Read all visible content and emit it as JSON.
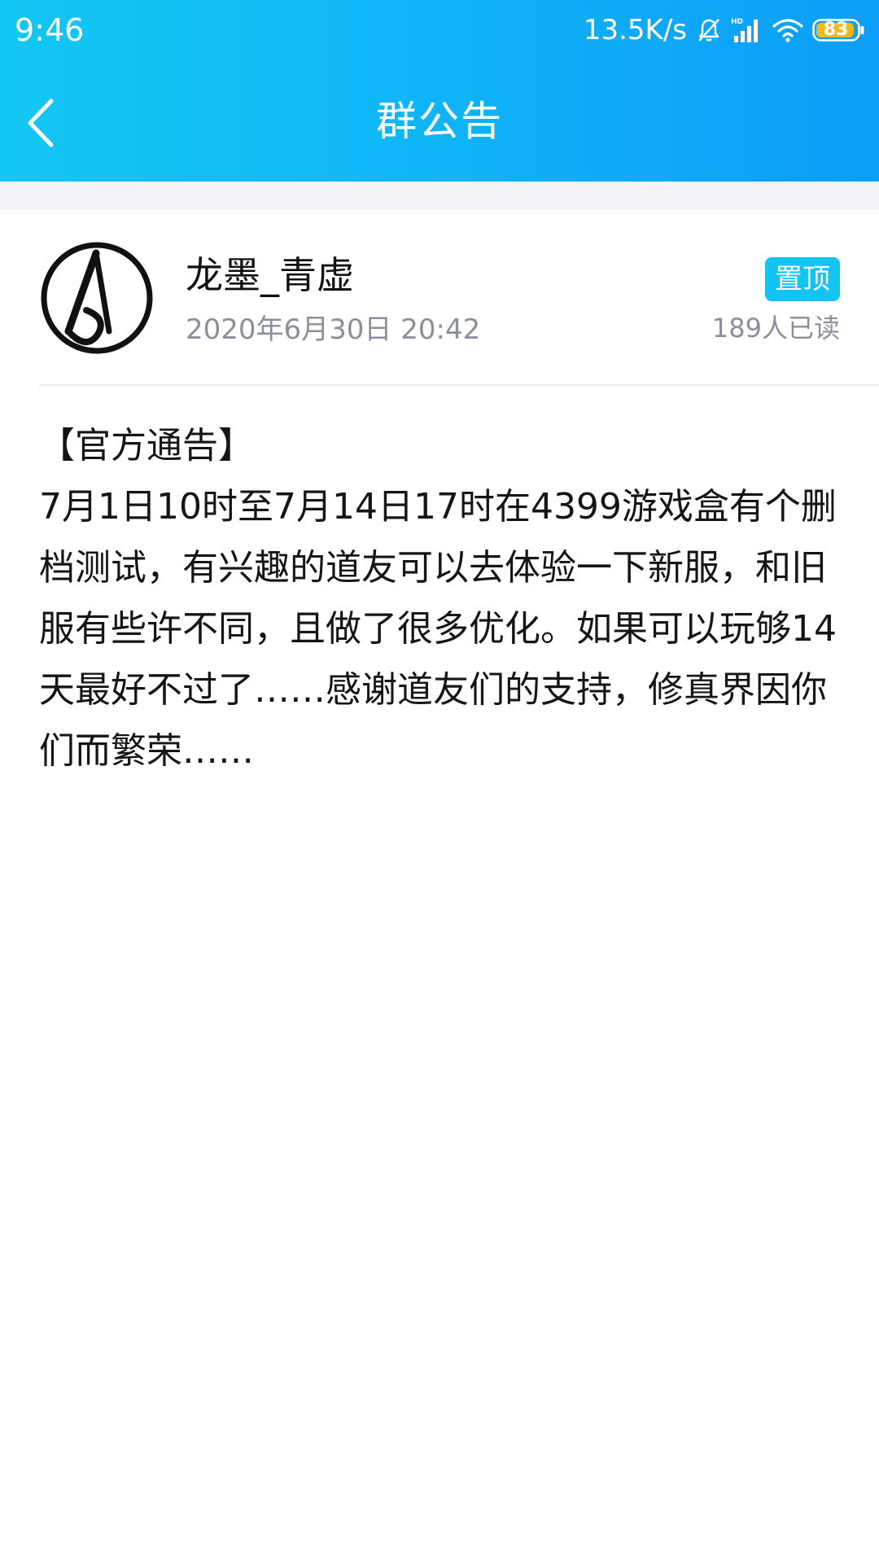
{
  "status_bar": {
    "time": "9:46",
    "network_speed": "13.5K/s",
    "battery_level": "83",
    "icons": [
      "bell-off-icon",
      "hd-signal-icon",
      "wifi-icon",
      "battery-icon"
    ]
  },
  "nav": {
    "title": "群公告",
    "back_icon": "chevron-left-icon"
  },
  "announcement": {
    "author": "龙墨_青虚",
    "date": "2020年6月30日 20:42",
    "pin_label": "置顶",
    "read_count": "189人已读",
    "heading": "【官方通告】",
    "body": "7月1日10时至7月14日17时在4399游戏盒有个删档测试，有兴趣的道友可以去体验一下新服，和旧服有些许不同，且做了很多优化。如果可以玩够14天最好不过了……感谢道友们的支持，修真界因你们而繁荣……"
  },
  "colors": {
    "header_gradient_start": "#13c7f3",
    "header_gradient_end": "#0c9ef8",
    "pin_badge": "#12c3f3",
    "secondary_text": "#8a8f99",
    "background_band": "#f2f3f7"
  }
}
